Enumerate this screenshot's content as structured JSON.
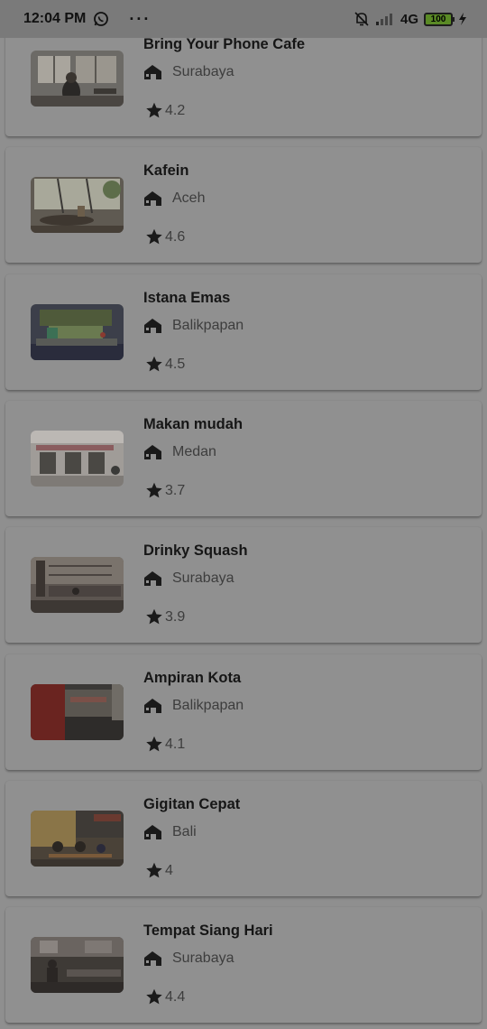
{
  "status_bar": {
    "time": "12:04 PM",
    "dots": "···",
    "network": "4G",
    "battery": "100"
  },
  "places": [
    {
      "name": "Bring Your Phone Cafe",
      "city": "Surabaya",
      "rating": "4.2"
    },
    {
      "name": "Kafein",
      "city": "Aceh",
      "rating": "4.6"
    },
    {
      "name": "Istana Emas",
      "city": "Balikpapan",
      "rating": "4.5"
    },
    {
      "name": "Makan mudah",
      "city": "Medan",
      "rating": "3.7"
    },
    {
      "name": "Drinky Squash",
      "city": "Surabaya",
      "rating": "3.9"
    },
    {
      "name": "Ampiran Kota",
      "city": "Balikpapan",
      "rating": "4.1"
    },
    {
      "name": "Gigitan Cepat",
      "city": "Bali",
      "rating": "4"
    },
    {
      "name": "Tempat Siang Hari",
      "city": "Surabaya",
      "rating": "4.4"
    }
  ]
}
